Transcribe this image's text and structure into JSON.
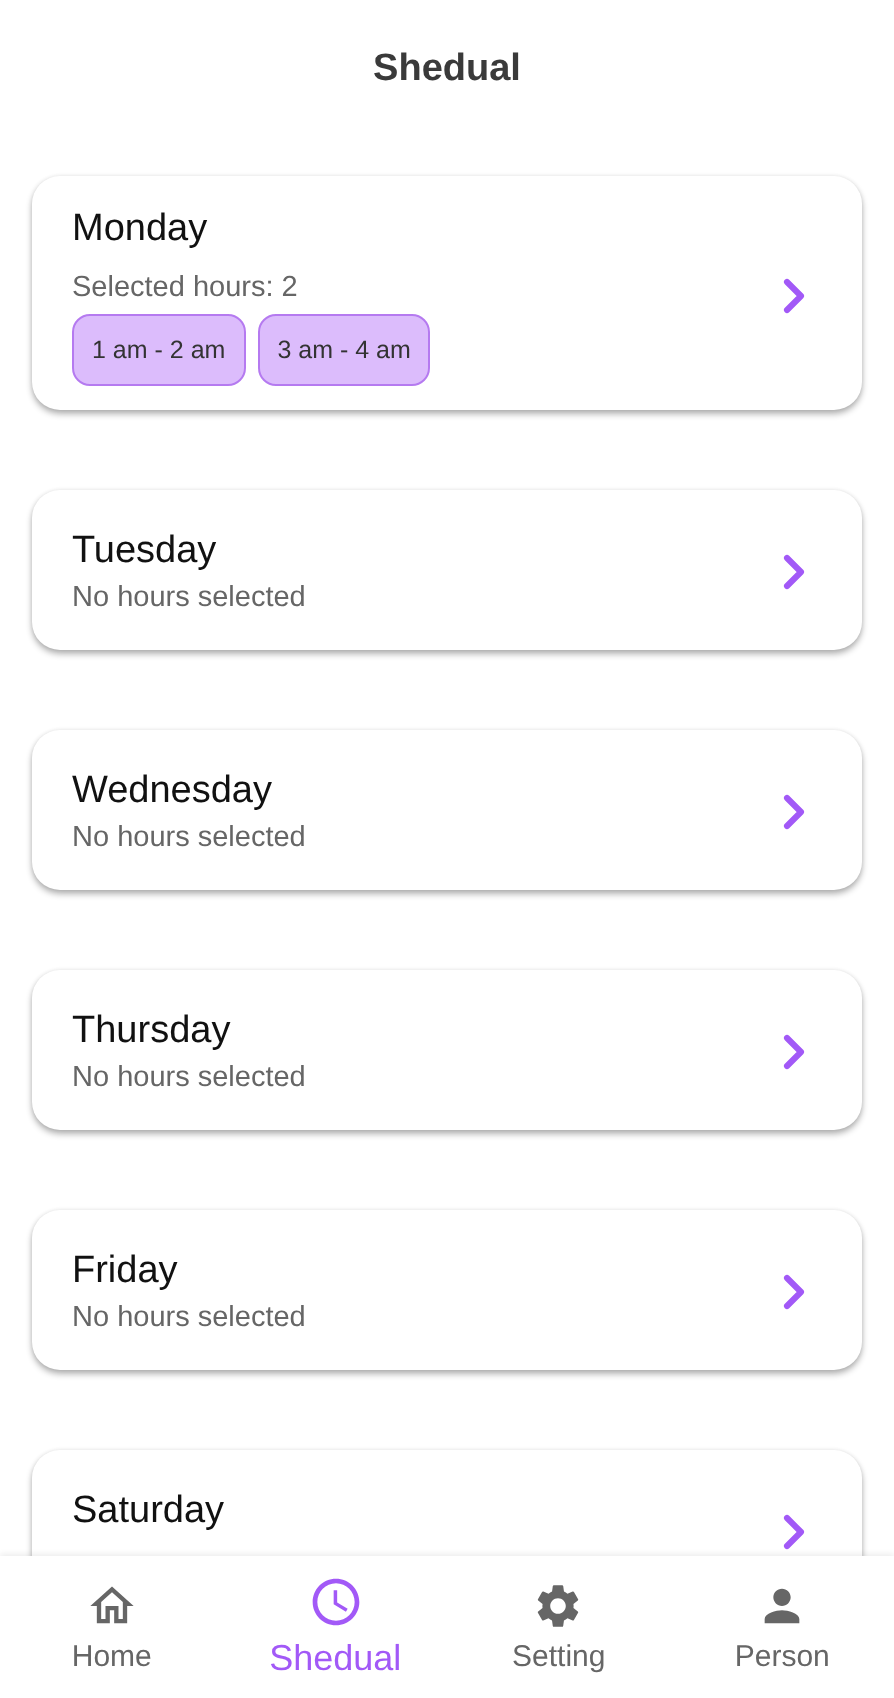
{
  "header": {
    "title": "Shedual"
  },
  "days": [
    {
      "name": "Monday",
      "summary": "Selected hours: 2",
      "hours": [
        "1 am - 2 am",
        "3 am - 4 am"
      ]
    },
    {
      "name": "Tuesday",
      "summary": "No hours selected"
    },
    {
      "name": "Wednesday",
      "summary": "No hours selected"
    },
    {
      "name": "Thursday",
      "summary": "No hours selected"
    },
    {
      "name": "Friday",
      "summary": "No hours selected"
    },
    {
      "name": "Saturday"
    }
  ],
  "nav": [
    {
      "kind": "home",
      "label": "Home",
      "selected": false
    },
    {
      "kind": "schedule",
      "label": "Shedual",
      "selected": true
    },
    {
      "kind": "settings",
      "label": "Setting",
      "selected": false
    },
    {
      "kind": "person",
      "label": "Person",
      "selected": false
    }
  ]
}
